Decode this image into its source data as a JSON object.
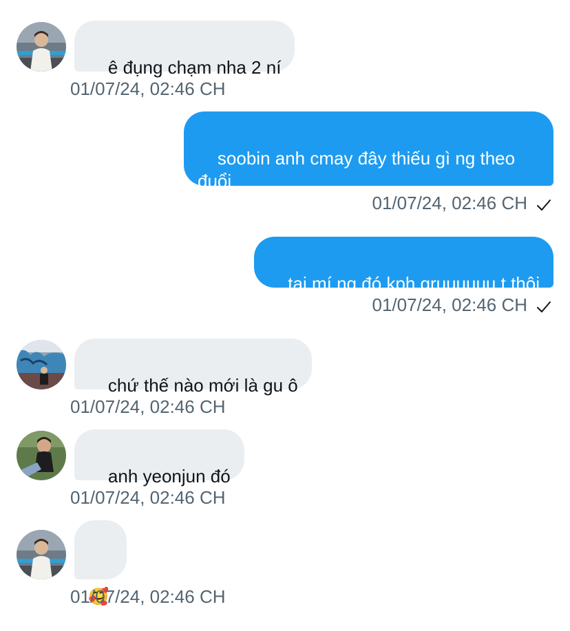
{
  "messages": [
    {
      "direction": "in",
      "text": "ê đụng chạm nha 2 ní",
      "timestamp": "01/07/24, 02:46 CH",
      "avatar": "avatar-1"
    },
    {
      "direction": "out",
      "text": "soobin anh cmay đây thiếu gì ng theo đuổi",
      "timestamp": "01/07/24, 02:46 CH",
      "status_icon": "check-icon"
    },
    {
      "direction": "out",
      "text": "tại mí ng đó kph gruuuuuu t thôi",
      "timestamp": "01/07/24, 02:46 CH",
      "status_icon": "check-icon"
    },
    {
      "direction": "in",
      "text": "chứ thế nào mới là gu ô",
      "timestamp": "01/07/24, 02:46 CH",
      "avatar": "avatar-2"
    },
    {
      "direction": "in",
      "text": "anh yeonjun đó",
      "timestamp": "01/07/24, 02:46 CH",
      "avatar": "avatar-3"
    },
    {
      "direction": "in",
      "text": "🥰",
      "timestamp": "01/07/24, 02:46 CH",
      "avatar": "avatar-1"
    }
  ],
  "colors": {
    "outgoing_bubble": "#1d9bf0",
    "incoming_bubble": "#eaeef1",
    "timestamp_text": "#536471",
    "incoming_text": "#0f1419"
  }
}
